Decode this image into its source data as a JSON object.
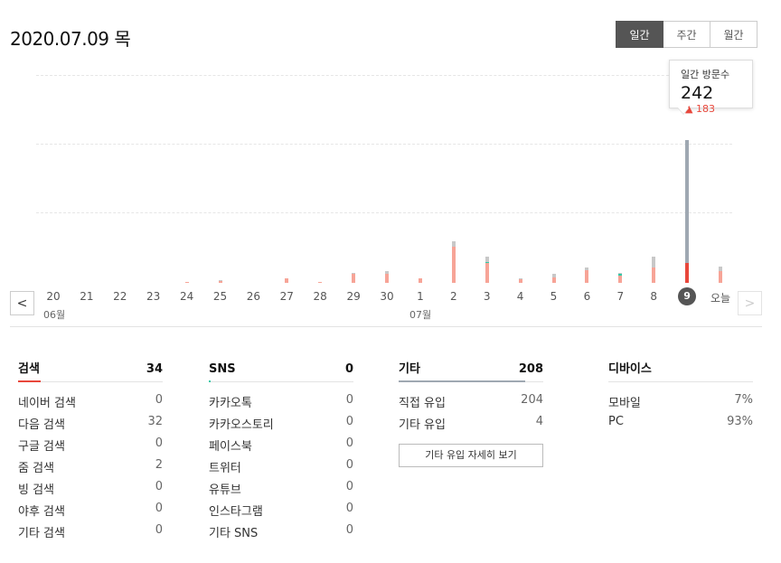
{
  "header": {
    "date": "2020.07.09 목",
    "tabs": [
      {
        "label": "일간",
        "active": true
      },
      {
        "label": "주간",
        "active": false
      },
      {
        "label": "월간",
        "active": false
      }
    ]
  },
  "tooltip": {
    "label": "일간 방문수",
    "value": "242",
    "delta": "183",
    "delta_icon": "triangle-up-icon"
  },
  "nav": {
    "prev_icon": "chevron-left-icon",
    "next_icon": "chevron-right-icon"
  },
  "colors": {
    "search": "#f7a497",
    "sns": "#30c9a7",
    "other": "#9fa8b2",
    "other_light": "#c8c8c8",
    "highlight": "#e8473b",
    "selected": "#555555"
  },
  "chart_data": {
    "type": "bar",
    "stacked": true,
    "categories": [
      "20",
      "21",
      "22",
      "23",
      "24",
      "25",
      "26",
      "27",
      "28",
      "29",
      "30",
      "1",
      "2",
      "3",
      "4",
      "5",
      "6",
      "7",
      "8",
      "9",
      "오늘"
    ],
    "month_labels": [
      "06월",
      "07월"
    ],
    "selected": "9",
    "series": [
      {
        "name": "검색",
        "values": [
          0,
          0,
          0,
          0,
          1,
          3,
          0,
          7,
          1,
          16,
          15,
          7,
          62,
          33,
          6,
          9,
          22,
          12,
          26,
          34,
          20
        ]
      },
      {
        "name": "SNS",
        "values": [
          0,
          0,
          0,
          0,
          0,
          0,
          0,
          0,
          0,
          0,
          0,
          0,
          0,
          3,
          0,
          0,
          0,
          3,
          0,
          0,
          0
        ]
      },
      {
        "name": "기타",
        "values": [
          0,
          0,
          0,
          0,
          0,
          1,
          0,
          0,
          0,
          1,
          5,
          0,
          9,
          9,
          1,
          6,
          4,
          2,
          19,
          208,
          7
        ]
      }
    ],
    "grid": true
  },
  "stats": {
    "search": {
      "title": "검색",
      "total": "34",
      "rows": [
        {
          "name": "네이버 검색",
          "value": "0"
        },
        {
          "name": "다음 검색",
          "value": "32"
        },
        {
          "name": "구글 검색",
          "value": "0"
        },
        {
          "name": "줌 검색",
          "value": "2"
        },
        {
          "name": "빙 검색",
          "value": "0"
        },
        {
          "name": "야후 검색",
          "value": "0"
        },
        {
          "name": "기타 검색",
          "value": "0"
        }
      ]
    },
    "sns": {
      "title": "SNS",
      "total": "0",
      "rows": [
        {
          "name": "카카오톡",
          "value": "0"
        },
        {
          "name": "카카오스토리",
          "value": "0"
        },
        {
          "name": "페이스북",
          "value": "0"
        },
        {
          "name": "트위터",
          "value": "0"
        },
        {
          "name": "유튜브",
          "value": "0"
        },
        {
          "name": "인스타그램",
          "value": "0"
        },
        {
          "name": "기타 SNS",
          "value": "0"
        }
      ]
    },
    "other": {
      "title": "기타",
      "total": "208",
      "rows": [
        {
          "name": "직접 유입",
          "value": "204"
        },
        {
          "name": "기타 유입",
          "value": "4"
        }
      ],
      "detail_button": "기타 유입 자세히 보기"
    },
    "device": {
      "title": "디바이스",
      "rows": [
        {
          "name": "모바일",
          "value": "7%"
        },
        {
          "name": "PC",
          "value": "93%"
        }
      ]
    }
  }
}
